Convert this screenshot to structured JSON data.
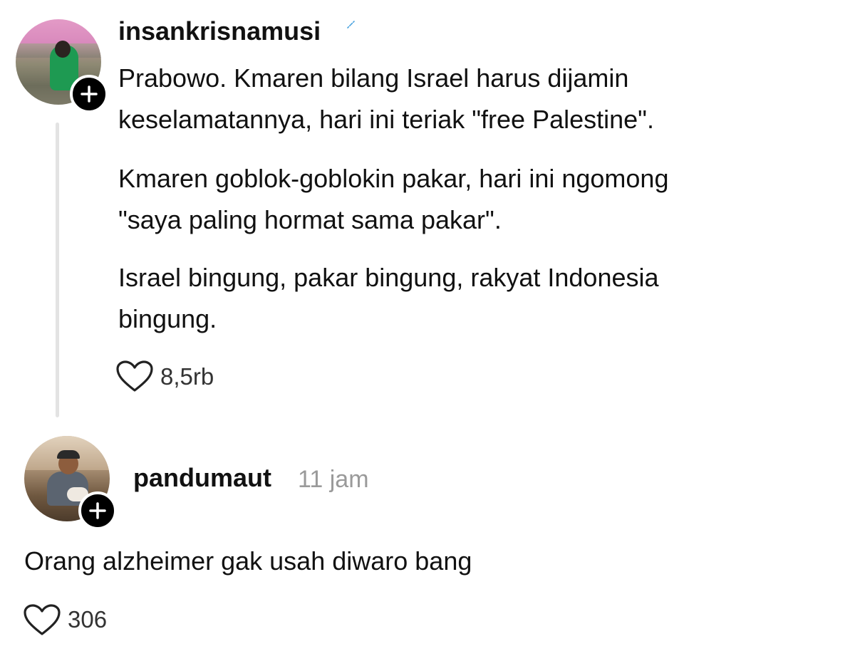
{
  "posts": [
    {
      "username": "insankrisnamusi",
      "paragraphs": [
        [
          "Prabowo. Kmaren bilang Israel harus dijamin",
          "keselamatannya, hari ini teriak \"free Palestine\"."
        ],
        [
          "Kmaren goblok-goblokin pakar, hari ini ngomong",
          "\"saya paling hormat sama pakar\"."
        ],
        [
          "Israel bingung, pakar bingung, rakyat Indonesia",
          "bingung."
        ]
      ],
      "likes": "8,5rb"
    },
    {
      "username": "pandumaut",
      "timestamp": "11 jam",
      "text": "Orang alzheimer gak usah diwaro bang",
      "likes": "306"
    }
  ],
  "icons": {
    "follow": "plus-icon",
    "like": "heart-outline-icon",
    "verified": "verified-badge-icon"
  },
  "colors": {
    "text": "#111111",
    "muted": "#9a9a9a",
    "thread_line": "#e3e3e3",
    "follow_bg": "#000000",
    "verified": "#4aa3df"
  }
}
